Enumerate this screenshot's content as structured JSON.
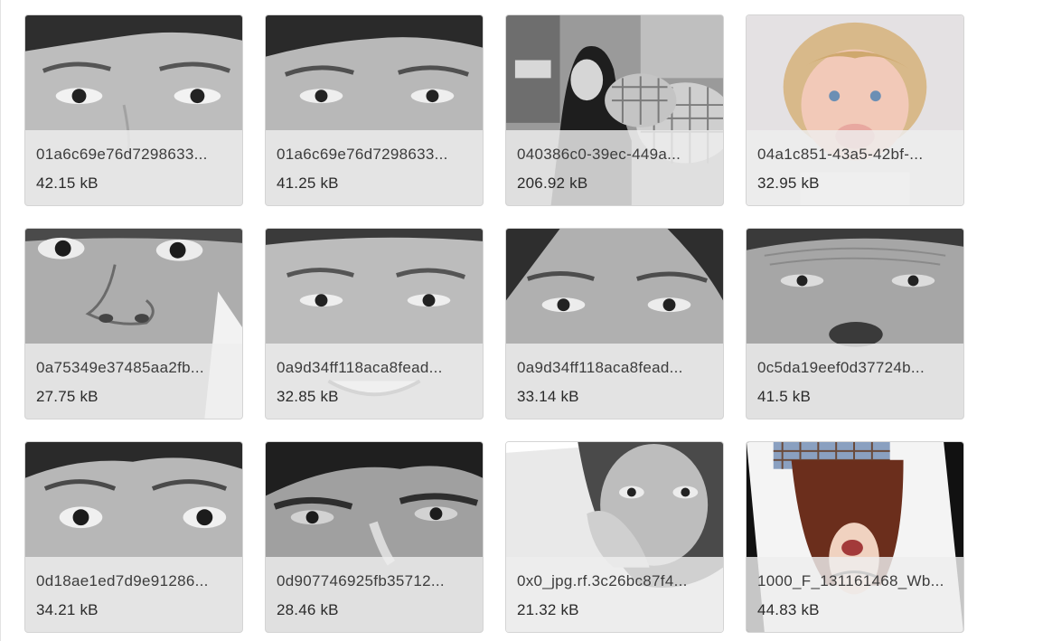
{
  "files": [
    {
      "name": "01a6c69e76d7298633...",
      "size": "42.15 kB",
      "thumb": "face-closeup-gray"
    },
    {
      "name": "01a6c69e76d7298633...",
      "size": "41.25 kB",
      "thumb": "face-closeup-gray"
    },
    {
      "name": "040386c0-39ec-449a...",
      "size": "206.92 kB",
      "thumb": "woman-hijab-cafe"
    },
    {
      "name": "04a1c851-43a5-42bf-...",
      "size": "32.95 kB",
      "thumb": "crying-toddler"
    },
    {
      "name": "0a75349e37485aa2fb...",
      "size": "27.75 kB",
      "thumb": "face-closeup-gray"
    },
    {
      "name": "0a9d34ff118aca8fead...",
      "size": "32.85 kB",
      "thumb": "face-smile-gray"
    },
    {
      "name": "0a9d34ff118aca8fead...",
      "size": "33.14 kB",
      "thumb": "face-closeup-gray"
    },
    {
      "name": "0c5da19eef0d37724b...",
      "size": "41.5 kB",
      "thumb": "older-face-gray"
    },
    {
      "name": "0d18ae1ed7d9e91286...",
      "size": "34.21 kB",
      "thumb": "surprised-face-gray"
    },
    {
      "name": "0d907746925fb35712...",
      "size": "28.46 kB",
      "thumb": "face-smile-gray"
    },
    {
      "name": "0x0_jpg.rf.3c26bc87f4...",
      "size": "21.32 kB",
      "thumb": "woman-hand-on-face"
    },
    {
      "name": "1000_F_131161468_Wb...",
      "size": "44.83 kB",
      "thumb": "upside-down-screaming-woman"
    }
  ]
}
